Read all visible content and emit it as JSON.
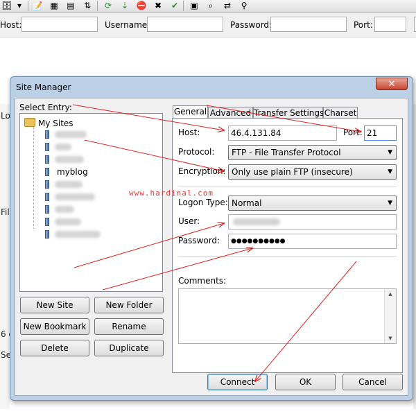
{
  "quickconnect": {
    "host_label": "Host:",
    "username_label": "Username:",
    "password_label": "Password:",
    "port_label": "Port:"
  },
  "background": {
    "left_frag_1": "Lo",
    "left_frag_2": "Fil",
    "left_frag_3": "6 d",
    "left_frag_4": "Se"
  },
  "dialog": {
    "title": "Site Manager",
    "close_glyph": "✕",
    "select_entry_label": "Select Entry:",
    "tree": {
      "root": "My Sites",
      "selected_site": "myblog"
    },
    "buttons": {
      "new_site": "New Site",
      "new_folder": "New Folder",
      "new_bookmark": "New Bookmark",
      "rename": "Rename",
      "delete": "Delete",
      "duplicate": "Duplicate",
      "connect": "Connect",
      "ok": "OK",
      "cancel": "Cancel"
    },
    "tabs": [
      "General",
      "Advanced",
      "Transfer Settings",
      "Charset"
    ],
    "general": {
      "host_label": "Host:",
      "host_value": "46.4.131.84",
      "port_label": "Port:",
      "port_value": "21",
      "protocol_label": "Protocol:",
      "protocol_value": "FTP - File Transfer Protocol",
      "encryption_label": "Encryption:",
      "encryption_value": "Only use plain FTP (insecure)",
      "logon_type_label": "Logon Type:",
      "logon_type_value": "Normal",
      "user_label": "User:",
      "password_label": "Password:",
      "password_value": "●●●●●●●●●●",
      "comments_label": "Comments:"
    }
  },
  "watermark": "www.hardinal.com",
  "colors": {
    "annotation_red": "#e02020",
    "dialog_frame": "#bcd0e6",
    "close_button": "#c74630"
  }
}
